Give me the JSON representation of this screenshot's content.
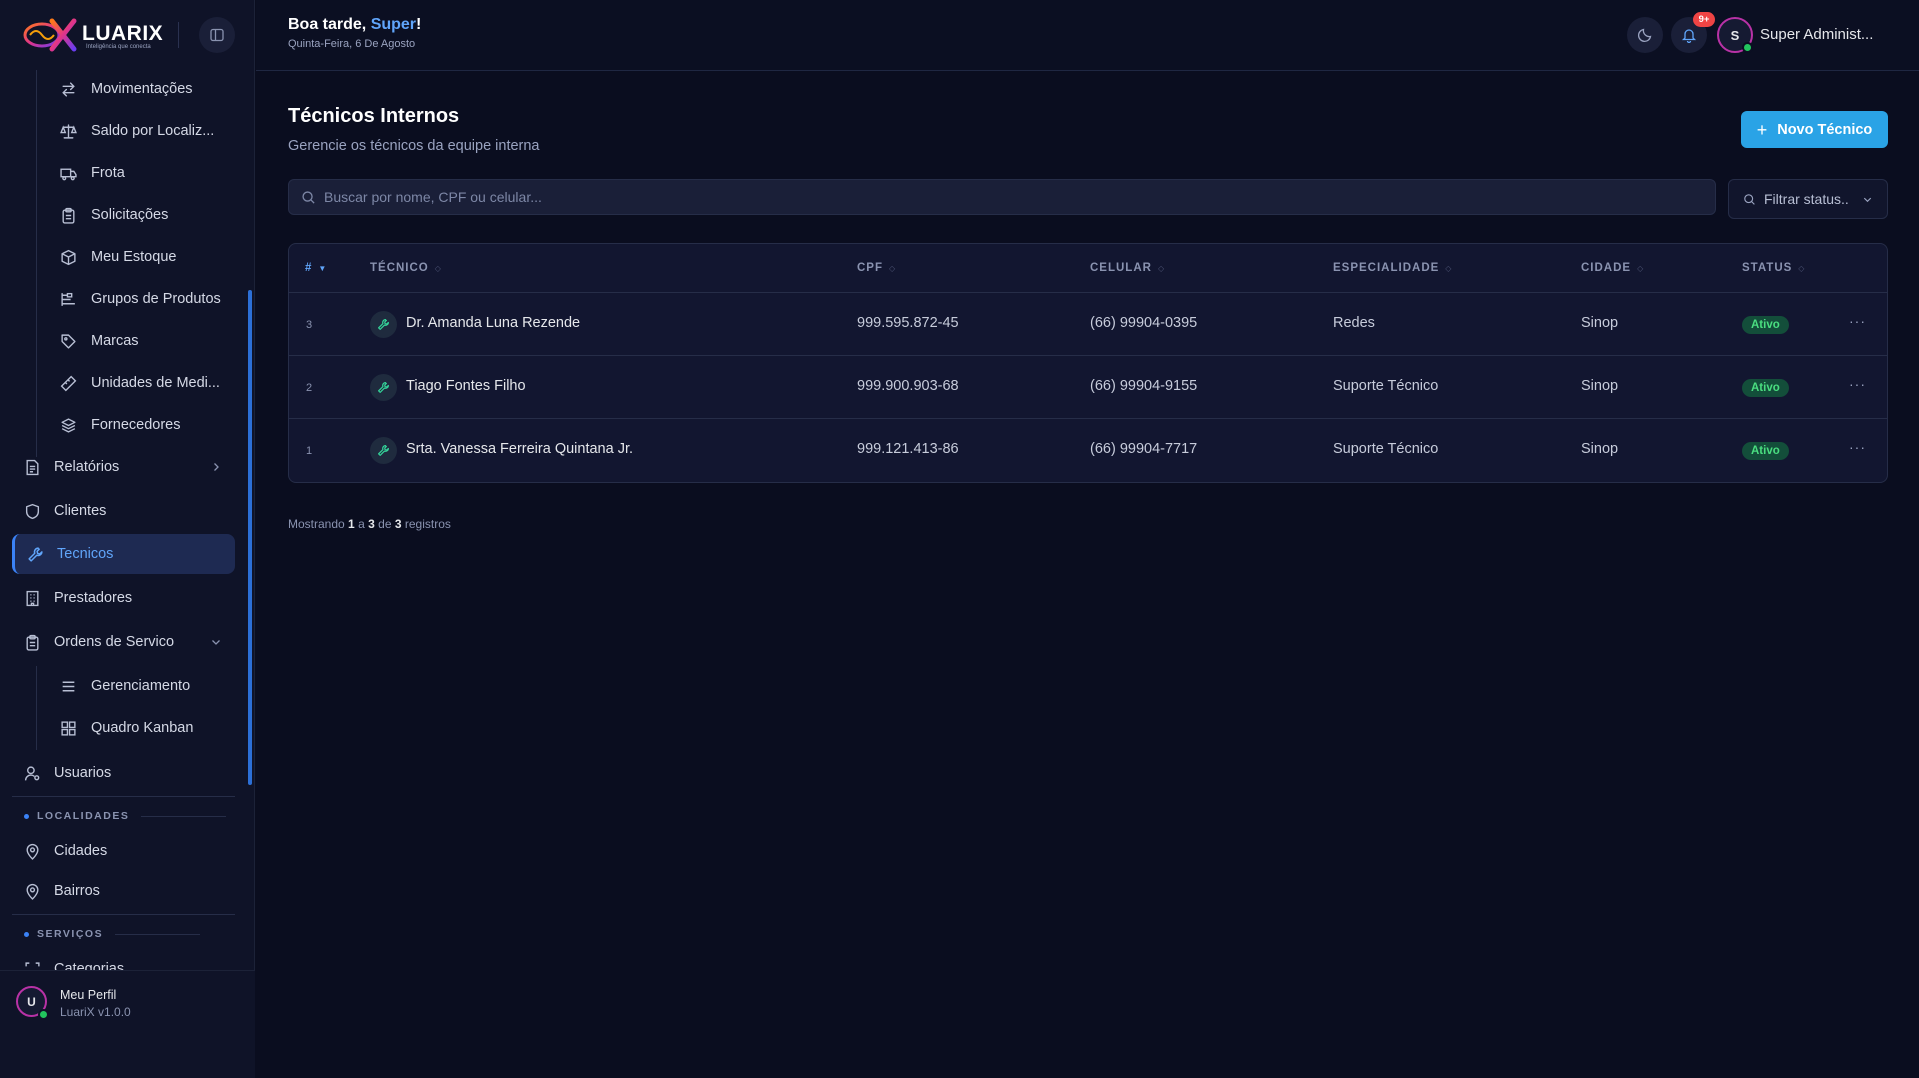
{
  "brand": {
    "logo_text": "LUARIX",
    "tagline": "Inteligência que conecta"
  },
  "sidebar": {
    "sub_items_top": [
      {
        "label": "Movimentações",
        "icon": "arrows-swap-icon"
      },
      {
        "label": "Saldo por Localiz...",
        "icon": "scale-icon"
      },
      {
        "label": "Frota",
        "icon": "truck-icon"
      },
      {
        "label": "Solicitações",
        "icon": "clipboard-icon"
      },
      {
        "label": "Meu Estoque",
        "icon": "box-icon"
      },
      {
        "label": "Grupos de Produtos",
        "icon": "group-icon"
      },
      {
        "label": "Marcas",
        "icon": "tag-icon"
      },
      {
        "label": "Unidades de Medi...",
        "icon": "ruler-icon"
      },
      {
        "label": "Fornecedores",
        "icon": "layers-icon"
      }
    ],
    "relatorios": "Relatórios",
    "clientes": "Clientes",
    "tecnicos": "Tecnicos",
    "prestadores": "Prestadores",
    "ordens": "Ordens de Servico",
    "ordens_sub": [
      {
        "label": "Gerenciamento",
        "icon": "list-icon"
      },
      {
        "label": "Quadro Kanban",
        "icon": "kanban-icon"
      }
    ],
    "usuarios": "Usuarios",
    "section_localidades": "LOCALIDADES",
    "cidades": "Cidades",
    "bairros": "Bairros",
    "section_servicos": "SERVIÇOS",
    "categorias": "Categorias"
  },
  "profile": {
    "initial": "U",
    "name": "Meu Perfil",
    "version": "LuariX v1.0.0"
  },
  "header": {
    "greeting_prefix": "Boa tarde, ",
    "greeting_name": "Super",
    "greeting_suffix": "!",
    "date": "Quinta-Feira, 6 De Agosto",
    "notifications_badge": "9+",
    "user_initial": "S",
    "user_name": "Super Administ..."
  },
  "page": {
    "title": "Técnicos Internos",
    "subtitle": "Gerencie os técnicos da equipe interna",
    "new_button": "Novo Técnico",
    "search_placeholder": "Buscar por nome, CPF ou celular...",
    "filter_label": "Filtrar status.."
  },
  "table": {
    "columns": {
      "id": "#",
      "tecnico": "TÉCNICO",
      "cpf": "CPF",
      "celular": "CELULAR",
      "especialidade": "ESPECIALIDADE",
      "cidade": "CIDADE",
      "status": "STATUS"
    },
    "rows": [
      {
        "id": "3",
        "nome": "Dr. Amanda Luna Rezende",
        "cpf": "999.595.872-45",
        "celular": "(66) 99904-0395",
        "especialidade": "Redes",
        "cidade": "Sinop",
        "status": "Ativo"
      },
      {
        "id": "2",
        "nome": "Tiago Fontes Filho",
        "cpf": "999.900.903-68",
        "celular": "(66) 99904-9155",
        "especialidade": "Suporte Técnico",
        "cidade": "Sinop",
        "status": "Ativo"
      },
      {
        "id": "1",
        "nome": "Srta. Vanessa Ferreira Quintana Jr.",
        "cpf": "999.121.413-86",
        "celular": "(66) 99904-7717",
        "especialidade": "Suporte Técnico",
        "cidade": "Sinop",
        "status": "Ativo"
      }
    ]
  },
  "pagination": {
    "prefix": "Mostrando",
    "from": "1",
    "sep1": "a",
    "to": "3",
    "sep2": "de",
    "total": "3",
    "suffix": "registros"
  },
  "colors": {
    "accent": "#2aa3e6",
    "active_link": "#60a5fa",
    "status_active": "#4ade80",
    "badge": "#ef4444"
  }
}
